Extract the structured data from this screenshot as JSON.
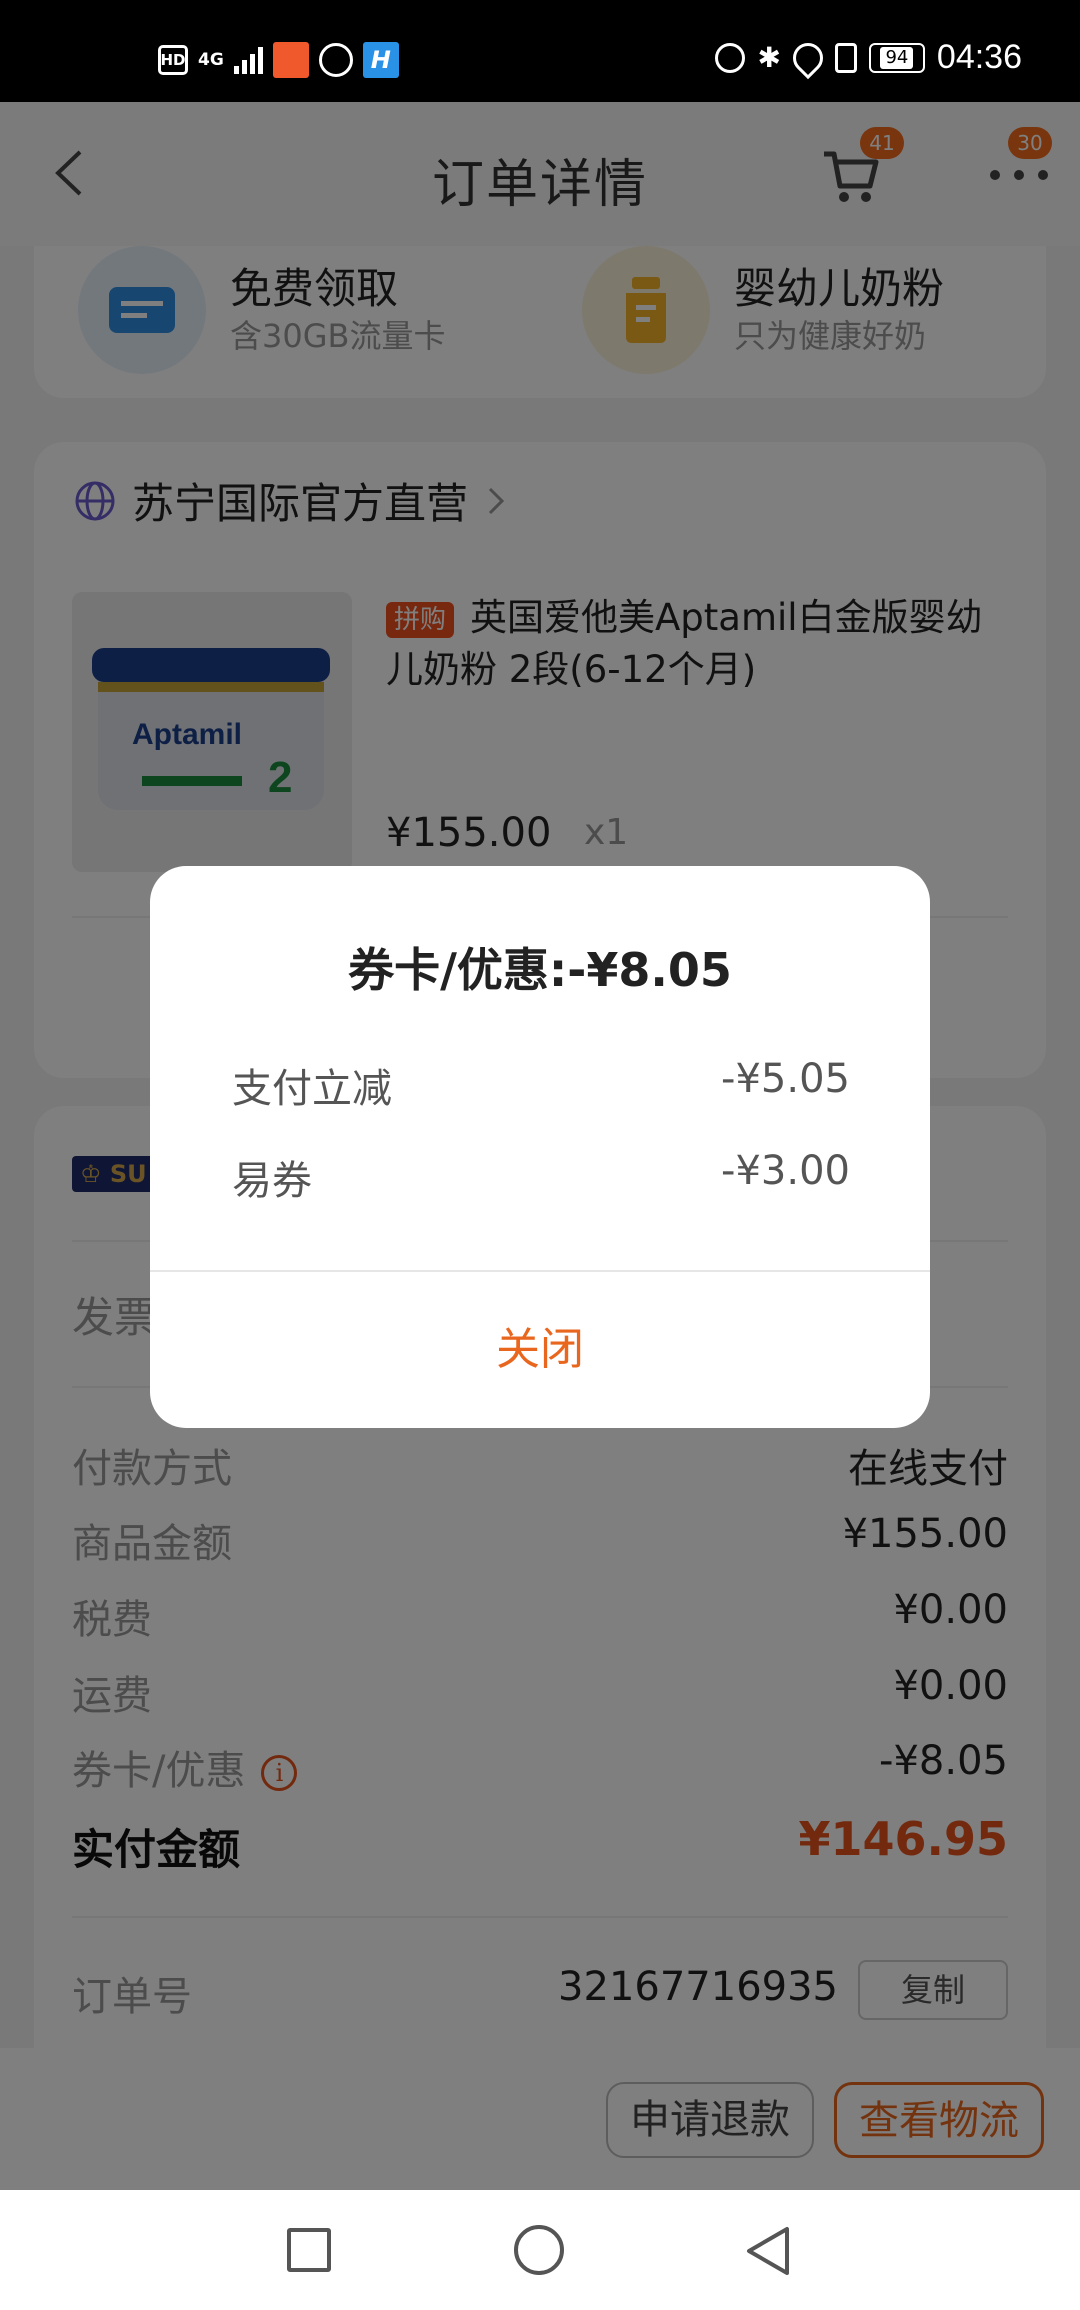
{
  "status_bar": {
    "hd": "HD",
    "network": "4G",
    "battery": "94",
    "time": "04:36"
  },
  "header": {
    "title": "订单详情",
    "cart_badge": "41",
    "more_badge": "30"
  },
  "promos": [
    {
      "title": "免费领取",
      "subtitle": "含30GB流量卡",
      "icon": "sim-card-icon",
      "color": "#2f8fe0"
    },
    {
      "title": "婴幼儿奶粉",
      "subtitle": "只为健康好奶",
      "icon": "milk-bottle-icon",
      "color": "#f2b228"
    }
  ],
  "order": {
    "shop_name": "苏宁国际官方直营",
    "tag": "拼购",
    "product_title": "英国爱他美Aptamil白金版婴幼儿奶粉 2段(6-12个月)",
    "price": "¥155.00",
    "quantity": "x1",
    "product_brand": "Aptamil",
    "product_stage": "2"
  },
  "details": {
    "svip": "SU",
    "invoice_label": "发票",
    "rows": [
      {
        "label": "付款方式",
        "value": "在线支付"
      },
      {
        "label": "商品金额",
        "value": "¥155.00"
      },
      {
        "label": "税费",
        "value": "¥0.00"
      },
      {
        "label": "运费",
        "value": "¥0.00"
      },
      {
        "label": "券卡/优惠",
        "value": "-¥8.05"
      }
    ],
    "total_label": "实付金额",
    "total_value": "¥146.95",
    "order_no_label": "订单号",
    "order_no": "32167716935",
    "copy_label": "复制"
  },
  "actions": {
    "refund": "申请退款",
    "logistics": "查看物流"
  },
  "dialog": {
    "title": "券卡/优惠:-¥8.05",
    "items": [
      {
        "label": "支付立减",
        "value": "-¥5.05"
      },
      {
        "label": "易券",
        "value": "-¥3.00"
      }
    ],
    "close": "关闭"
  },
  "colors": {
    "accent": "#e9661e",
    "price_red": "#e5531c",
    "overlay": "rgba(0,0,0,0.5)"
  }
}
